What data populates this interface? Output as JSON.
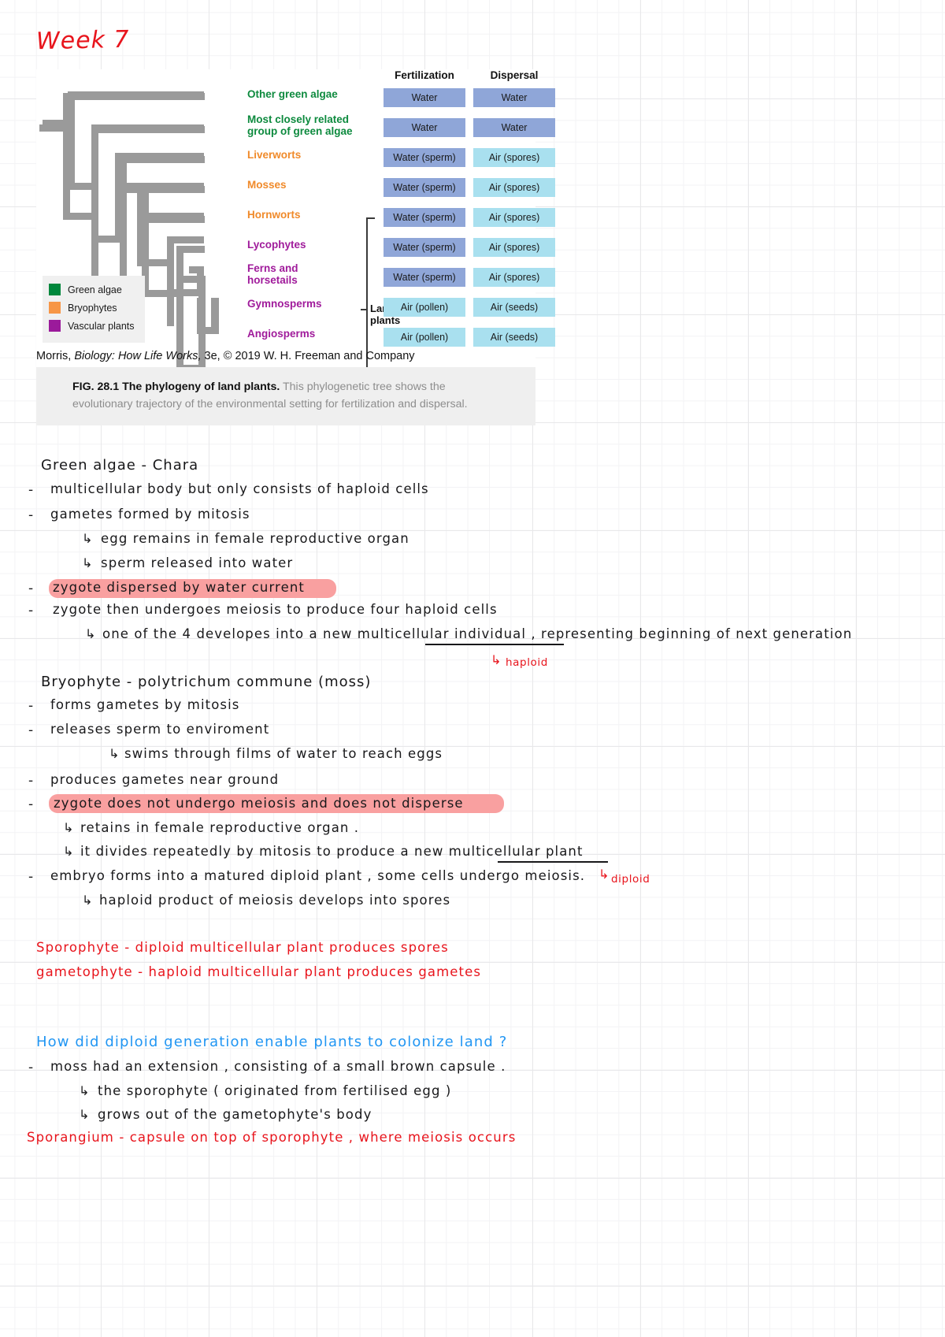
{
  "page": {
    "title": "Week 7"
  },
  "figure": {
    "column_headers": [
      "Fertilization",
      "Dispersal"
    ],
    "group_label": "Land\nplants",
    "taxa": [
      {
        "name": "Other green algae",
        "group": "green",
        "fertilization": "Water",
        "dispersal": "Water",
        "fert_tone": "dark",
        "disp_tone": "dark"
      },
      {
        "name": "Most closely related\ngroup of green algae",
        "group": "green",
        "fertilization": "Water",
        "dispersal": "Water",
        "fert_tone": "dark",
        "disp_tone": "dark"
      },
      {
        "name": "Liverworts",
        "group": "orange",
        "fertilization": "Water (sperm)",
        "dispersal": "Air (spores)",
        "fert_tone": "dark",
        "disp_tone": "light"
      },
      {
        "name": "Mosses",
        "group": "orange",
        "fertilization": "Water (sperm)",
        "dispersal": "Air (spores)",
        "fert_tone": "dark",
        "disp_tone": "light"
      },
      {
        "name": "Hornworts",
        "group": "orange",
        "fertilization": "Water (sperm)",
        "dispersal": "Air (spores)",
        "fert_tone": "dark",
        "disp_tone": "light"
      },
      {
        "name": "Lycophytes",
        "group": "purple",
        "fertilization": "Water (sperm)",
        "dispersal": "Air (spores)",
        "fert_tone": "dark",
        "disp_tone": "light"
      },
      {
        "name": "Ferns and\nhorsetails",
        "group": "purple",
        "fertilization": "Water (sperm)",
        "dispersal": "Air (spores)",
        "fert_tone": "dark",
        "disp_tone": "light"
      },
      {
        "name": "Gymnosperms",
        "group": "purple",
        "fertilization": "Air (pollen)",
        "dispersal": "Air (seeds)",
        "fert_tone": "light",
        "disp_tone": "light"
      },
      {
        "name": "Angiosperms",
        "group": "purple",
        "fertilization": "Air (pollen)",
        "dispersal": "Air (seeds)",
        "fert_tone": "light",
        "disp_tone": "light"
      }
    ],
    "legend": [
      {
        "label": "Green algae",
        "color": "#00873c"
      },
      {
        "label": "Bryophytes",
        "color": "#f79646"
      },
      {
        "label": "Vascular plants",
        "color": "#9b1a9b"
      }
    ],
    "source": "Morris, Biology: How Life Works, 3e, © 2019 W. H. Freeman and Company",
    "source_parts": {
      "pre": "Morris, ",
      "italic": "Biology: How Life Works,",
      "post": " 3e, © 2019 W. H. Freeman and Company"
    },
    "caption": {
      "bold": "FIG. 28.1 The phylogeny of land plants.",
      "rest": " This phylogenetic tree shows the evolutionary trajectory of the environmental setting for fertilization and dispersal."
    },
    "colors": {
      "branch": "#9a9a9a",
      "cell_dark": "#8fa6d8",
      "cell_light": "#a9e0ef",
      "green": "#0d8a3e",
      "orange": "#f08a2a",
      "purple": "#a01b9b"
    }
  },
  "notes": {
    "highlight_color": "#f9a0a0",
    "red_color": "#e8141c",
    "blue_color": "#2196f3",
    "sections": [
      {
        "id": "green-algae",
        "heading": "Green  algae   -   Chara",
        "lines": [
          {
            "marker": "-",
            "text": "multicellular   body   but   only  consists   of   haploid   cells"
          },
          {
            "marker": "-",
            "text": "gametes     formed    by    mitosis"
          },
          {
            "marker": "↳",
            "text": "egg  remains   in   female   reproductive  organ"
          },
          {
            "marker": "↳",
            "text": "sperm   released    into   water"
          },
          {
            "marker": "-",
            "text": "zygote   dispersed    by water    current",
            "highlight": true
          },
          {
            "marker": "-",
            "text": "zygote   then    undergoes    meiosis   to    produce   four  haploid  cells"
          },
          {
            "marker": "↳",
            "text": "one    of the 4    developes    into    a    new   multicellular individual ,  representing  beginning  of next generation",
            "underline": "multicellular individual"
          }
        ],
        "annotation": {
          "text": "haploid",
          "arrow": "↳"
        }
      },
      {
        "id": "bryophyte",
        "heading": "Bryophyte    -    polytrichum  commune  (moss)",
        "lines": [
          {
            "marker": "-",
            "text": "forms   gametes   by   mitosis"
          },
          {
            "marker": "-",
            "text": "releases  sperm  to   enviroment"
          },
          {
            "marker": "↳",
            "text": "swims    through   films  of  water   to   reach eggs"
          },
          {
            "marker": "-",
            "text": "produces   gametes   near   ground"
          },
          {
            "marker": "-",
            "text": "zygote   does   not   undergo   meiosis   and   does  not   disperse",
            "highlight": true
          },
          {
            "marker": "↳",
            "text": "retains  in   female  reproductive  organ ."
          },
          {
            "marker": "↳",
            "text": "it divides    repeatedly   by   mitosis  to   produce   a new    multicellular  plant",
            "underline": "multicellular  plant"
          },
          {
            "marker": "-",
            "text": "embryo   forms   into   a   matured   diploid  plant , some  cells undergo  meiosis."
          },
          {
            "marker": "↳",
            "text": "haploid    product   of   meiosis   develops   into    spores"
          }
        ],
        "annotation": {
          "text": "diploid",
          "arrow": "↳"
        }
      }
    ],
    "definitions": [
      "Sporophyte -  diploid   multicellular   plant     produces  spores",
      "gametophyte -   haploid   multicellular  plant    produces  gametes"
    ],
    "question": "How   did   diploid  generation   enable   plants  to   colonize  land ?",
    "question_lines": [
      {
        "marker": "-",
        "text": "moss    had    an    extension   ,  consisting    of    a   small    brown   capsule ."
      },
      {
        "marker": "↳",
        "text": "the    sporophyte   ( originated    from   fertilised egg )"
      },
      {
        "marker": "↳",
        "text": "grows out    of  the    gametophyte's   body"
      }
    ],
    "final_line": "Sporangium -   capsule   on   top  of    sporophyte   ,   where  meiosis  occurs"
  }
}
